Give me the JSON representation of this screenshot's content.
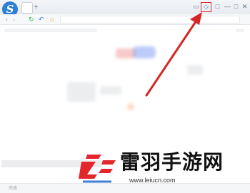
{
  "colors": {
    "accent_red": "#e02b2b",
    "logo_blue": "#2c7fd3"
  },
  "browser": {
    "logo_letter": "S",
    "tab_add_glyph": "+",
    "controls": {
      "highlighted_glyph": "◇",
      "skin_glyph": "▭",
      "minimize_glyph": "—",
      "maximize_glyph": "□",
      "close_glyph": "✕"
    },
    "toolbar": {
      "back_glyph": "‹",
      "forward_glyph": "›",
      "refresh_glyph": "↻",
      "undo_glyph": "↶",
      "home_glyph": "⌂"
    }
  },
  "statusbar": {
    "text": "完成"
  },
  "watermark": {
    "title": "雷羽手游网",
    "url": "www.leiucn.com"
  },
  "icons": [
    "app-logo-icon",
    "refresh-icon",
    "undo-icon",
    "home-icon",
    "highlighted-menu-icon",
    "close-icon",
    "arrow-icon"
  ]
}
